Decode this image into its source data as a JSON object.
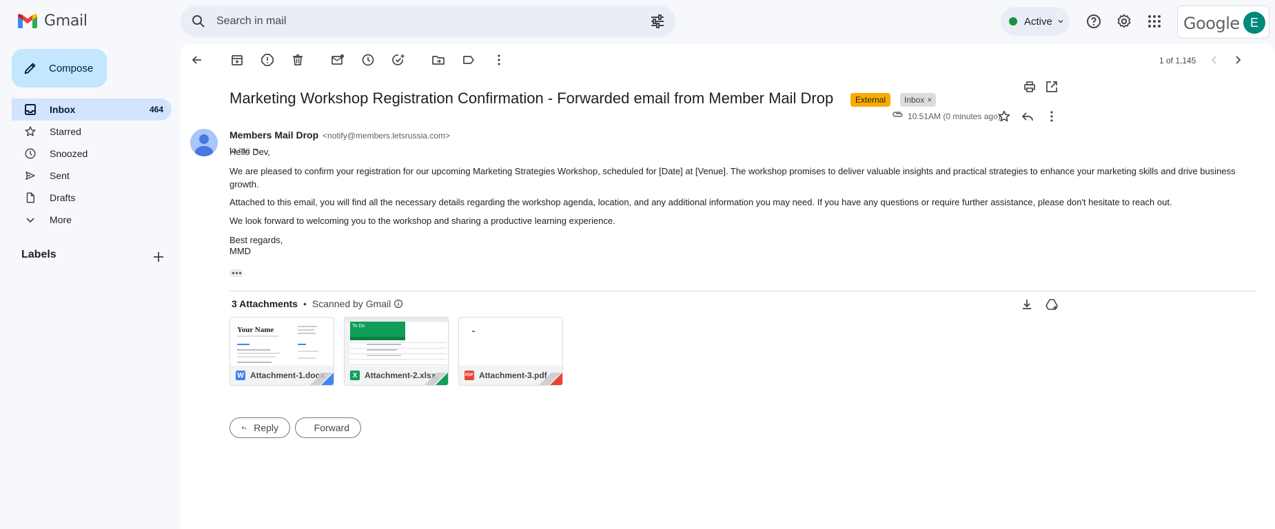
{
  "app": {
    "name": "Gmail",
    "brand_red": "#ea4335"
  },
  "search": {
    "placeholder": "Search in mail"
  },
  "header": {
    "status": "Active",
    "google_label": "Google",
    "avatar_letter": "E"
  },
  "compose": {
    "label": "Compose"
  },
  "sidebar": {
    "items": [
      {
        "label": "Inbox",
        "count": "464",
        "icon": "inbox-icon",
        "active": true
      },
      {
        "label": "Starred",
        "icon": "star-icon"
      },
      {
        "label": "Snoozed",
        "icon": "clock-icon"
      },
      {
        "label": "Sent",
        "icon": "send-icon"
      },
      {
        "label": "Drafts",
        "icon": "draft-icon"
      },
      {
        "label": "More",
        "icon": "chevron-down-icon"
      }
    ],
    "labels_heading": "Labels"
  },
  "toolbar": {
    "pager": "1 of 1,145"
  },
  "email": {
    "subject": "Marketing Workshop Registration Confirmation - Forwarded email from Member Mail Drop",
    "badge_external": "External",
    "badge_inbox": "Inbox",
    "sender_name": "Members Mail Drop",
    "sender_email": "<notify@members.letsrussia.com>",
    "to": "to me",
    "time": "10:51AM (0 minutes ago)",
    "body": [
      "Hello Dev,",
      "We are pleased to confirm your registration for our upcoming Marketing Strategies Workshop, scheduled for [Date] at [Venue]. The workshop promises to deliver valuable insights and practical strategies to enhance your marketing skills and drive business growth.",
      "Attached to this email, you will find all the necessary details regarding the workshop agenda, location, and any additional information you may need. If you have any questions or require further assistance, please don't hesitate to reach out.",
      "We look forward to welcoming you to the workshop and sharing a productive learning experience.",
      "Best regards,",
      "MMD"
    ]
  },
  "attachments": {
    "count_label": "3 Attachments",
    "scanned": "Scanned by Gmail",
    "files": [
      {
        "name": "Attachment-1.docx",
        "icon": "word-icon",
        "color": "#4285f4"
      },
      {
        "name": "Attachment-2.xlsx",
        "icon": "excel-icon",
        "color": "#0f9d58"
      },
      {
        "name": "Attachment-3.pdf",
        "icon": "pdf-icon",
        "color": "#ea4335"
      }
    ],
    "preview_name": "Your Name",
    "preview_sheet": "To Do"
  },
  "actions": {
    "reply": "Reply",
    "forward": "Forward"
  }
}
